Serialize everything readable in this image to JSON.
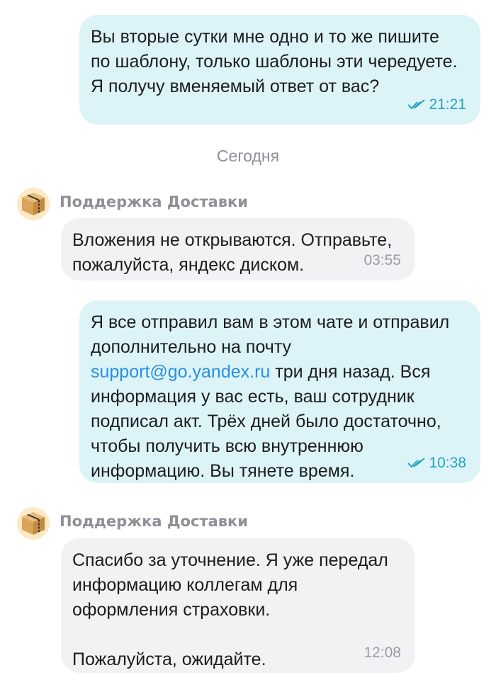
{
  "divider": "Сегодня",
  "messages": [
    {
      "direction": "outgoing",
      "text": "Вы вторые сутки мне одно и то же пишите по шаблону, только шаблоны эти чередуете. Я получу вменяемый ответ от вас?",
      "time": "21:21",
      "status": "read"
    },
    {
      "direction": "incoming",
      "sender": "Поддержка Доставки",
      "text": "Вложения не открываются. Отправьте, пожалуйста, яндекс диском.",
      "time": "03:55"
    },
    {
      "direction": "outgoing",
      "text_before": "Я все отправил вам в этом чате и отправил дополнительно на почту ",
      "link": "support@go.yandex.ru",
      "text_after": " три дня назад. Вся информация у вас есть, ваш сотрудник подписал акт. Трёх дней было достаточно, чтобы получить всю внутреннюю информацию. Вы тянете время.",
      "time": "10:38",
      "status": "read"
    },
    {
      "direction": "incoming",
      "sender": "Поддержка Доставки",
      "text": "Спасибо за уточнение. Я уже передал информацию коллегам для оформления страховки.\n\nПожалуйста, ожидайте.",
      "time": "12:08"
    }
  ],
  "colors": {
    "outgoing_bubble": "#dcf4f8",
    "incoming_bubble": "#f2f2f4",
    "read_check": "#26a3ba",
    "link": "#2b8fe0"
  },
  "icons": {
    "avatar": "parcel-box-icon",
    "read_status": "double-check-icon"
  }
}
